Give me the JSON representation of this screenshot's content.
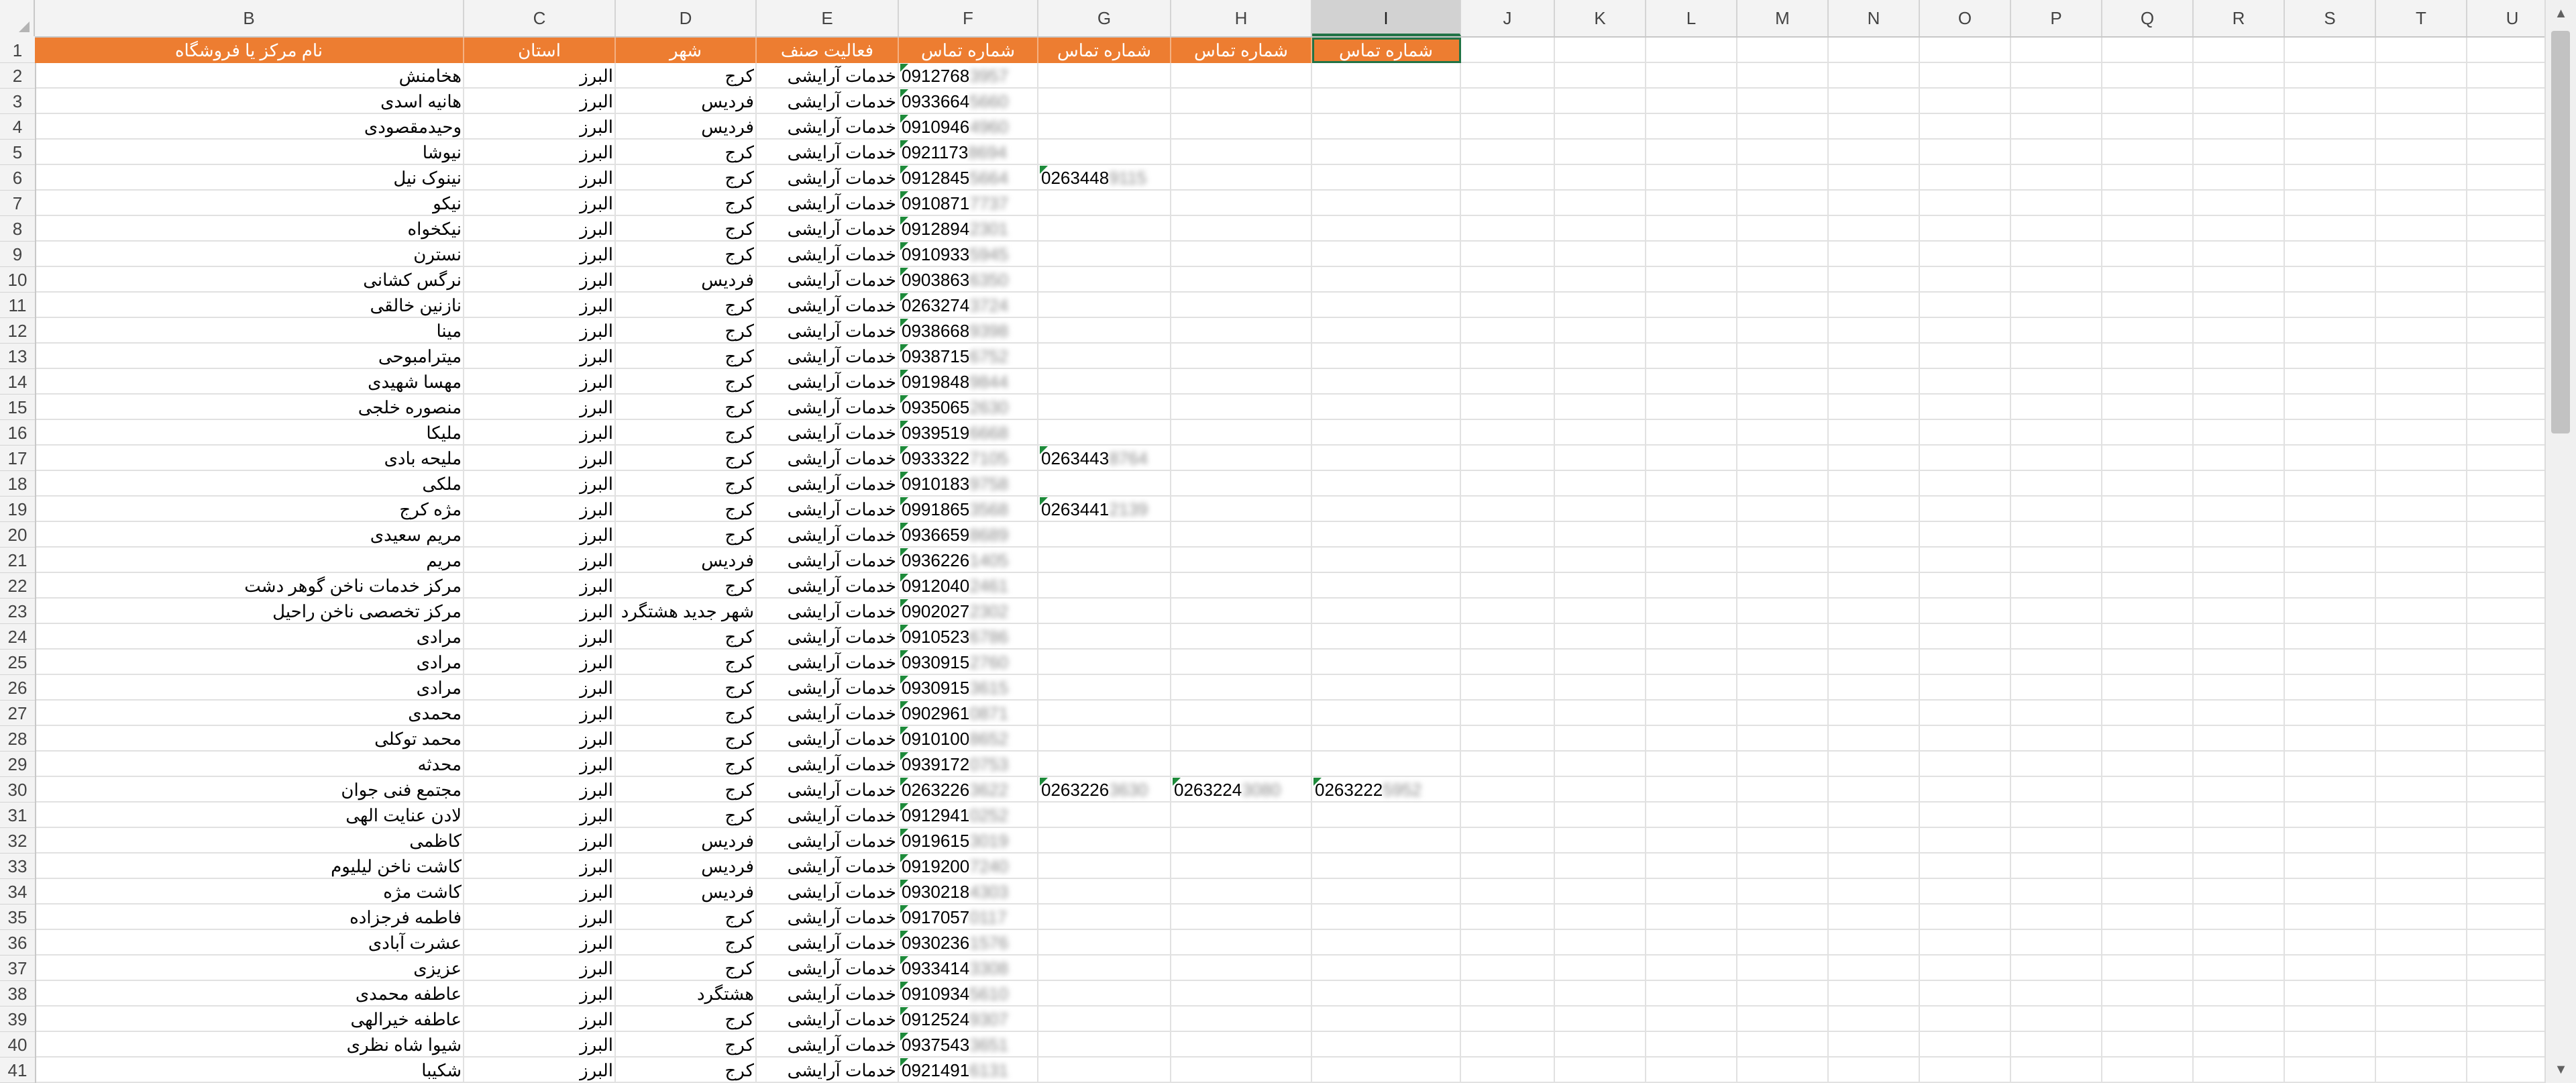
{
  "columns": [
    "B",
    "C",
    "D",
    "E",
    "F",
    "G",
    "H",
    "I",
    "J",
    "K",
    "L",
    "M",
    "N",
    "O",
    "P",
    "Q",
    "R",
    "S",
    "T",
    "U"
  ],
  "selected_column": "I",
  "header_row": {
    "row_number": "1",
    "B": "نام مرکز یا فروشگاه",
    "C": "استان",
    "D": "شهر",
    "E": "فعالیت صنف",
    "F": "شماره تماس",
    "G": "شماره تماس",
    "H": "شماره تماس",
    "I": "شماره تماس"
  },
  "rows": [
    {
      "n": "2",
      "name": "هخامنش",
      "province": "البرز",
      "city": "کرج",
      "activity": "خدمات آرایشی",
      "phone": "0912768",
      "phone_hidden": "3957",
      "phone2": "",
      "phone2_hidden": "",
      "phone3": "",
      "phone3_hidden": "",
      "phone4": "",
      "phone4_hidden": ""
    },
    {
      "n": "3",
      "name": "هانیه اسدی",
      "province": "البرز",
      "city": "فردیس",
      "activity": "خدمات آرایشی",
      "phone": "0933664",
      "phone_hidden": "5660",
      "phone2": "",
      "phone2_hidden": "",
      "phone3": "",
      "phone3_hidden": "",
      "phone4": "",
      "phone4_hidden": ""
    },
    {
      "n": "4",
      "name": "وحیدمقصودی",
      "province": "البرز",
      "city": "فردیس",
      "activity": "خدمات آرایشی",
      "phone": "0910946",
      "phone_hidden": "4960",
      "phone2": "",
      "phone2_hidden": "",
      "phone3": "",
      "phone3_hidden": "",
      "phone4": "",
      "phone4_hidden": ""
    },
    {
      "n": "5",
      "name": "نیوشا",
      "province": "البرز",
      "city": "کرج",
      "activity": "خدمات آرایشی",
      "phone": "0921173",
      "phone_hidden": "8694",
      "phone2": "",
      "phone2_hidden": "",
      "phone3": "",
      "phone3_hidden": "",
      "phone4": "",
      "phone4_hidden": ""
    },
    {
      "n": "6",
      "name": "نینوک نیل",
      "province": "البرز",
      "city": "کرج",
      "activity": "خدمات آرایشی",
      "phone": "0912845",
      "phone_hidden": "5664",
      "phone2": "0263448",
      "phone2_hidden": "9115",
      "phone3": "",
      "phone3_hidden": "",
      "phone4": "",
      "phone4_hidden": ""
    },
    {
      "n": "7",
      "name": "نیکو",
      "province": "البرز",
      "city": "کرج",
      "activity": "خدمات آرایشی",
      "phone": "0910871",
      "phone_hidden": "7737",
      "phone2": "",
      "phone2_hidden": "",
      "phone3": "",
      "phone3_hidden": "",
      "phone4": "",
      "phone4_hidden": ""
    },
    {
      "n": "8",
      "name": "نیکخواه",
      "province": "البرز",
      "city": "کرج",
      "activity": "خدمات آرایشی",
      "phone": "0912894",
      "phone_hidden": "2301",
      "phone2": "",
      "phone2_hidden": "",
      "phone3": "",
      "phone3_hidden": "",
      "phone4": "",
      "phone4_hidden": ""
    },
    {
      "n": "9",
      "name": "نسترن",
      "province": "البرز",
      "city": "کرج",
      "activity": "خدمات آرایشی",
      "phone": "0910933",
      "phone_hidden": "5945",
      "phone2": "",
      "phone2_hidden": "",
      "phone3": "",
      "phone3_hidden": "",
      "phone4": "",
      "phone4_hidden": ""
    },
    {
      "n": "10",
      "name": "نرگس کشانی",
      "province": "البرز",
      "city": "فردیس",
      "activity": "خدمات آرایشی",
      "phone": "0903863",
      "phone_hidden": "6350",
      "phone2": "",
      "phone2_hidden": "",
      "phone3": "",
      "phone3_hidden": "",
      "phone4": "",
      "phone4_hidden": ""
    },
    {
      "n": "11",
      "name": "نازنین خالقی",
      "province": "البرز",
      "city": "کرج",
      "activity": "خدمات آرایشی",
      "phone": "0263274",
      "phone_hidden": "3724",
      "phone2": "",
      "phone2_hidden": "",
      "phone3": "",
      "phone3_hidden": "",
      "phone4": "",
      "phone4_hidden": ""
    },
    {
      "n": "12",
      "name": "مینا",
      "province": "البرز",
      "city": "کرج",
      "activity": "خدمات آرایشی",
      "phone": "0938668",
      "phone_hidden": "9398",
      "phone2": "",
      "phone2_hidden": "",
      "phone3": "",
      "phone3_hidden": "",
      "phone4": "",
      "phone4_hidden": ""
    },
    {
      "n": "13",
      "name": "میترامبوحی",
      "province": "البرز",
      "city": "کرج",
      "activity": "خدمات آرایشی",
      "phone": "0938715",
      "phone_hidden": "6752",
      "phone2": "",
      "phone2_hidden": "",
      "phone3": "",
      "phone3_hidden": "",
      "phone4": "",
      "phone4_hidden": ""
    },
    {
      "n": "14",
      "name": "مهسا شهیدی",
      "province": "البرز",
      "city": "کرج",
      "activity": "خدمات آرایشی",
      "phone": "0919848",
      "phone_hidden": "9844",
      "phone2": "",
      "phone2_hidden": "",
      "phone3": "",
      "phone3_hidden": "",
      "phone4": "",
      "phone4_hidden": ""
    },
    {
      "n": "15",
      "name": "منصوره خلجی",
      "province": "البرز",
      "city": "کرج",
      "activity": "خدمات آرایشی",
      "phone": "0935065",
      "phone_hidden": "2630",
      "phone2": "",
      "phone2_hidden": "",
      "phone3": "",
      "phone3_hidden": "",
      "phone4": "",
      "phone4_hidden": ""
    },
    {
      "n": "16",
      "name": "ملیکا",
      "province": "البرز",
      "city": "کرج",
      "activity": "خدمات آرایشی",
      "phone": "0939519",
      "phone_hidden": "6668",
      "phone2": "",
      "phone2_hidden": "",
      "phone3": "",
      "phone3_hidden": "",
      "phone4": "",
      "phone4_hidden": ""
    },
    {
      "n": "17",
      "name": "ملیحه بادی",
      "province": "البرز",
      "city": "کرج",
      "activity": "خدمات آرایشی",
      "phone": "0933322",
      "phone_hidden": "7105",
      "phone2": "0263443",
      "phone2_hidden": "8764",
      "phone3": "",
      "phone3_hidden": "",
      "phone4": "",
      "phone4_hidden": ""
    },
    {
      "n": "18",
      "name": "ملکی",
      "province": "البرز",
      "city": "کرج",
      "activity": "خدمات آرایشی",
      "phone": "0910183",
      "phone_hidden": "9758",
      "phone2": "",
      "phone2_hidden": "",
      "phone3": "",
      "phone3_hidden": "",
      "phone4": "",
      "phone4_hidden": ""
    },
    {
      "n": "19",
      "name": "مژه کرج",
      "province": "البرز",
      "city": "کرج",
      "activity": "خدمات آرایشی",
      "phone": "0991865",
      "phone_hidden": "3568",
      "phone2": "0263441",
      "phone2_hidden": "2139",
      "phone3": "",
      "phone3_hidden": "",
      "phone4": "",
      "phone4_hidden": ""
    },
    {
      "n": "20",
      "name": "مریم سعیدی",
      "province": "البرز",
      "city": "کرج",
      "activity": "خدمات آرایشی",
      "phone": "0936659",
      "phone_hidden": "8689",
      "phone2": "",
      "phone2_hidden": "",
      "phone3": "",
      "phone3_hidden": "",
      "phone4": "",
      "phone4_hidden": ""
    },
    {
      "n": "21",
      "name": "مریم",
      "province": "البرز",
      "city": "فردیس",
      "activity": "خدمات آرایشی",
      "phone": "0936226",
      "phone_hidden": "1405",
      "phone2": "",
      "phone2_hidden": "",
      "phone3": "",
      "phone3_hidden": "",
      "phone4": "",
      "phone4_hidden": ""
    },
    {
      "n": "22",
      "name": "مرکز خدمات ناخن گوهر دشت",
      "province": "البرز",
      "city": "کرج",
      "activity": "خدمات آرایشی",
      "phone": "0912040",
      "phone_hidden": "2461",
      "phone2": "",
      "phone2_hidden": "",
      "phone3": "",
      "phone3_hidden": "",
      "phone4": "",
      "phone4_hidden": ""
    },
    {
      "n": "23",
      "name": "مرکز تخصصی ناخن راحیل",
      "province": "البرز",
      "city": "شهر جدید هشتگرد",
      "activity": "خدمات آرایشی",
      "phone": "0902027",
      "phone_hidden": "2302",
      "phone2": "",
      "phone2_hidden": "",
      "phone3": "",
      "phone3_hidden": "",
      "phone4": "",
      "phone4_hidden": ""
    },
    {
      "n": "24",
      "name": "مرادی",
      "province": "البرز",
      "city": "کرج",
      "activity": "خدمات آرایشی",
      "phone": "0910523",
      "phone_hidden": "6786",
      "phone2": "",
      "phone2_hidden": "",
      "phone3": "",
      "phone3_hidden": "",
      "phone4": "",
      "phone4_hidden": ""
    },
    {
      "n": "25",
      "name": "مرادی",
      "province": "البرز",
      "city": "کرج",
      "activity": "خدمات آرایشی",
      "phone": "0930915",
      "phone_hidden": "2760",
      "phone2": "",
      "phone2_hidden": "",
      "phone3": "",
      "phone3_hidden": "",
      "phone4": "",
      "phone4_hidden": ""
    },
    {
      "n": "26",
      "name": "مرادی",
      "province": "البرز",
      "city": "کرج",
      "activity": "خدمات آرایشی",
      "phone": "0930915",
      "phone_hidden": "3615",
      "phone2": "",
      "phone2_hidden": "",
      "phone3": "",
      "phone3_hidden": "",
      "phone4": "",
      "phone4_hidden": ""
    },
    {
      "n": "27",
      "name": "محمدی",
      "province": "البرز",
      "city": "کرج",
      "activity": "خدمات آرایشی",
      "phone": "0902961",
      "phone_hidden": "0871",
      "phone2": "",
      "phone2_hidden": "",
      "phone3": "",
      "phone3_hidden": "",
      "phone4": "",
      "phone4_hidden": ""
    },
    {
      "n": "28",
      "name": "محمد توکلی",
      "province": "البرز",
      "city": "کرج",
      "activity": "خدمات آرایشی",
      "phone": "0910100",
      "phone_hidden": "8652",
      "phone2": "",
      "phone2_hidden": "",
      "phone3": "",
      "phone3_hidden": "",
      "phone4": "",
      "phone4_hidden": ""
    },
    {
      "n": "29",
      "name": "محدثه",
      "province": "البرز",
      "city": "کرج",
      "activity": "خدمات آرایشی",
      "phone": "0939172",
      "phone_hidden": "0753",
      "phone2": "",
      "phone2_hidden": "",
      "phone3": "",
      "phone3_hidden": "",
      "phone4": "",
      "phone4_hidden": ""
    },
    {
      "n": "30",
      "name": "مجتمع فنی جوان",
      "province": "البرز",
      "city": "کرج",
      "activity": "خدمات آرایشی",
      "phone": "0263226",
      "phone_hidden": "3622",
      "phone2": "0263226",
      "phone2_hidden": "3630",
      "phone3": "0263224",
      "phone3_hidden": "3080",
      "phone4": "0263222",
      "phone4_hidden": "5952"
    },
    {
      "n": "31",
      "name": "لادن عنایت الهی",
      "province": "البرز",
      "city": "کرج",
      "activity": "خدمات آرایشی",
      "phone": "0912941",
      "phone_hidden": "0252",
      "phone2": "",
      "phone2_hidden": "",
      "phone3": "",
      "phone3_hidden": "",
      "phone4": "",
      "phone4_hidden": ""
    },
    {
      "n": "32",
      "name": "کاظمی",
      "province": "البرز",
      "city": "فردیس",
      "activity": "خدمات آرایشی",
      "phone": "0919615",
      "phone_hidden": "3019",
      "phone2": "",
      "phone2_hidden": "",
      "phone3": "",
      "phone3_hidden": "",
      "phone4": "",
      "phone4_hidden": ""
    },
    {
      "n": "33",
      "name": "کاشت ناخن لیلیوم",
      "province": "البرز",
      "city": "فردیس",
      "activity": "خدمات آرایشی",
      "phone": "0919200",
      "phone_hidden": "7240",
      "phone2": "",
      "phone2_hidden": "",
      "phone3": "",
      "phone3_hidden": "",
      "phone4": "",
      "phone4_hidden": ""
    },
    {
      "n": "34",
      "name": "کاشت مژه",
      "province": "البرز",
      "city": "فردیس",
      "activity": "خدمات آرایشی",
      "phone": "0930218",
      "phone_hidden": "4303",
      "phone2": "",
      "phone2_hidden": "",
      "phone3": "",
      "phone3_hidden": "",
      "phone4": "",
      "phone4_hidden": ""
    },
    {
      "n": "35",
      "name": "فاطمه فرجزاده",
      "province": "البرز",
      "city": "کرج",
      "activity": "خدمات آرایشی",
      "phone": "0917057",
      "phone_hidden": "0117",
      "phone2": "",
      "phone2_hidden": "",
      "phone3": "",
      "phone3_hidden": "",
      "phone4": "",
      "phone4_hidden": ""
    },
    {
      "n": "36",
      "name": "عشرت آبادی",
      "province": "البرز",
      "city": "کرج",
      "activity": "خدمات آرایشی",
      "phone": "0930236",
      "phone_hidden": "1576",
      "phone2": "",
      "phone2_hidden": "",
      "phone3": "",
      "phone3_hidden": "",
      "phone4": "",
      "phone4_hidden": ""
    },
    {
      "n": "37",
      "name": "عزیزی",
      "province": "البرز",
      "city": "کرج",
      "activity": "خدمات آرایشی",
      "phone": "0933414",
      "phone_hidden": "3308",
      "phone2": "",
      "phone2_hidden": "",
      "phone3": "",
      "phone3_hidden": "",
      "phone4": "",
      "phone4_hidden": ""
    },
    {
      "n": "38",
      "name": "عاطفه محمدی",
      "province": "البرز",
      "city": "هشتگرد",
      "activity": "خدمات آرایشی",
      "phone": "0910934",
      "phone_hidden": "5610",
      "phone2": "",
      "phone2_hidden": "",
      "phone3": "",
      "phone3_hidden": "",
      "phone4": "",
      "phone4_hidden": ""
    },
    {
      "n": "39",
      "name": "عاطفه خیرالهی",
      "province": "البرز",
      "city": "کرج",
      "activity": "خدمات آرایشی",
      "phone": "0912524",
      "phone_hidden": "9307",
      "phone2": "",
      "phone2_hidden": "",
      "phone3": "",
      "phone3_hidden": "",
      "phone4": "",
      "phone4_hidden": ""
    },
    {
      "n": "40",
      "name": "شیوا شاه نظری",
      "province": "البرز",
      "city": "کرج",
      "activity": "خدمات آرایشی",
      "phone": "0937543",
      "phone_hidden": "3651",
      "phone2": "",
      "phone2_hidden": "",
      "phone3": "",
      "phone3_hidden": "",
      "phone4": "",
      "phone4_hidden": ""
    },
    {
      "n": "41",
      "name": "شکیبا",
      "province": "البرز",
      "city": "کرج",
      "activity": "خدمات آرایشی",
      "phone": "0921491",
      "phone_hidden": "6131",
      "phone2": "",
      "phone2_hidden": "",
      "phone3": "",
      "phone3_hidden": "",
      "phone4": "",
      "phone4_hidden": ""
    }
  ],
  "colors": {
    "header_fill": "#ed7d31",
    "header_text": "#ffffff",
    "error_indicator": "#1d8a3a",
    "selection": "#217346"
  },
  "icons": {
    "scroll_up": "▲",
    "scroll_down": "▼"
  }
}
